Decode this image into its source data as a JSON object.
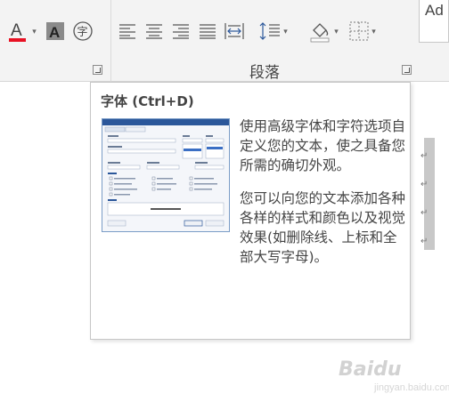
{
  "ribbon": {
    "paragraph_group_label": "段落",
    "styles_preview": "Ad",
    "font_color_glyph": "A",
    "shading_glyph": "A",
    "enclose_glyph": "字"
  },
  "tooltip": {
    "title": "字体 (Ctrl+D)",
    "para1": "使用高级字体和字符选项自定义您的文本，使之具备您所需的确切外观。",
    "para2": "您可以向您的文本添加各种各样的样式和颜色以及视觉效果(如删除线、上标和全部大写字母)。"
  },
  "document": {
    "paragraph_mark": "↵"
  },
  "watermark": {
    "brand": "Baidu",
    "sub": "jingyan.baidu.com"
  },
  "colors": {
    "ribbon_bg": "#f3f3f3",
    "font_color_red": "#e81123",
    "accent_blue": "#2b579a"
  }
}
